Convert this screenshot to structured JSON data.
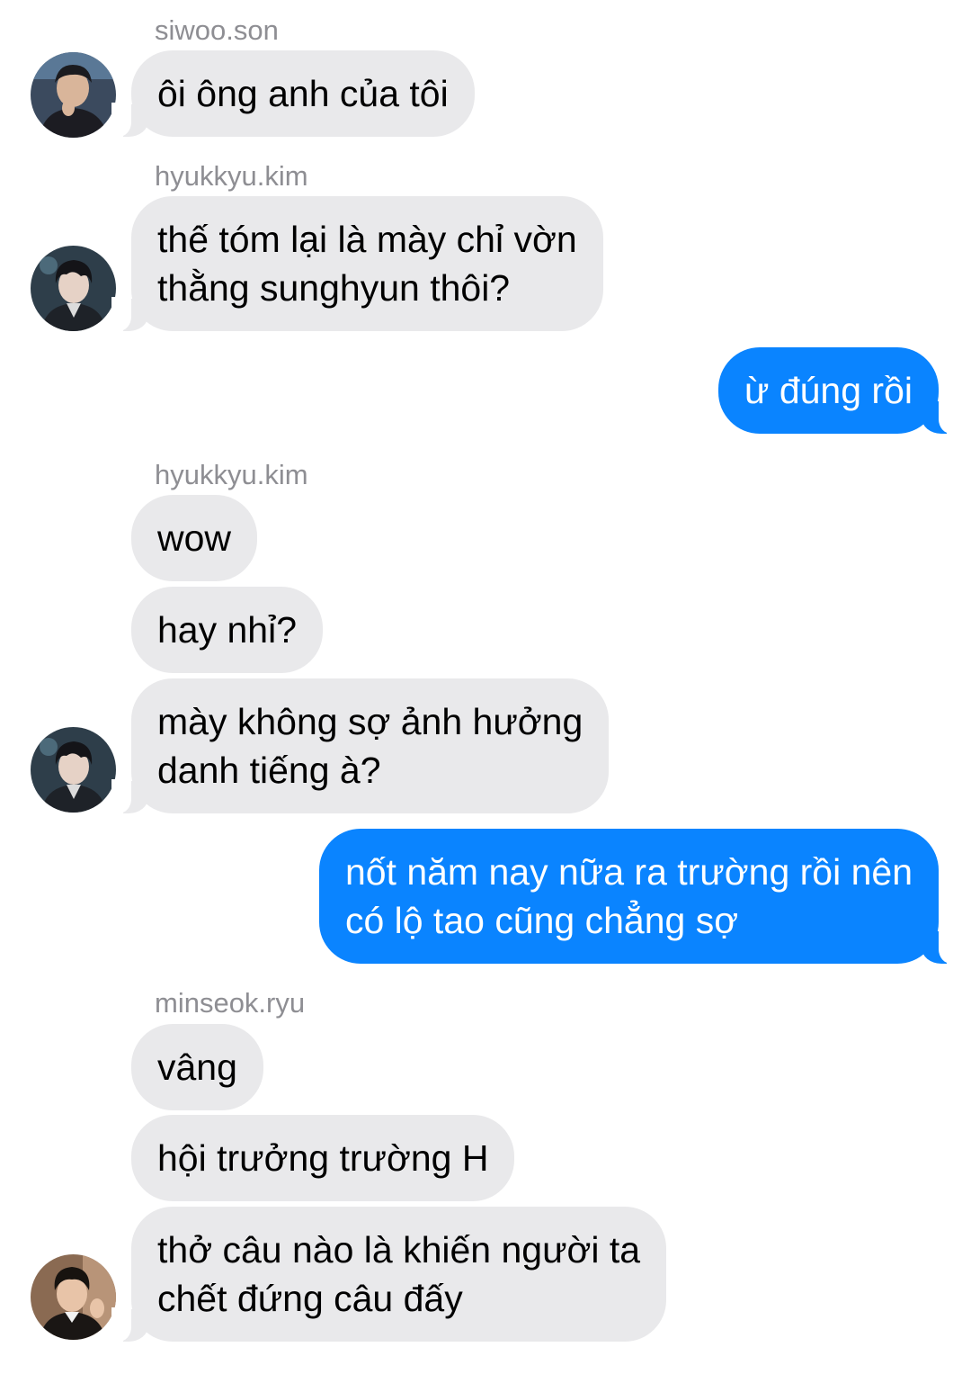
{
  "conversation": {
    "groups": [
      {
        "sender": "siwoo.son",
        "avatar": "profile-photo-siwoo",
        "messages": [
          "ôi ông anh của tôi"
        ]
      },
      {
        "sender": "hyukkyu.kim",
        "avatar": "profile-photo-hyukkyu",
        "messages": [
          [
            "thế tóm lại là mày chỉ vờn",
            "thằng sunghyun thôi?"
          ]
        ]
      },
      {
        "sender": "me",
        "messages": [
          "ừ đúng rồi"
        ]
      },
      {
        "sender": "hyukkyu.kim",
        "avatar": "profile-photo-hyukkyu",
        "messages": [
          "wow",
          "hay nhỉ?",
          [
            "mày không sợ ảnh hưởng",
            "danh tiếng à?"
          ]
        ]
      },
      {
        "sender": "me",
        "messages": [
          [
            "nốt năm nay nữa ra trường rồi nên",
            "có lộ tao cũng chẳng sợ"
          ]
        ]
      },
      {
        "sender": "minseok.ryu",
        "avatar": "profile-photo-minseok",
        "messages": [
          "vâng",
          "hội trưởng trường H",
          [
            "thở câu nào là khiến người ta",
            "chết đứng câu đấy"
          ]
        ]
      }
    ]
  },
  "colors": {
    "incoming_bubble": "#e9e9eb",
    "outgoing_bubble": "#0a84ff",
    "sender_name": "#8e8e93",
    "background": "#ffffff"
  }
}
